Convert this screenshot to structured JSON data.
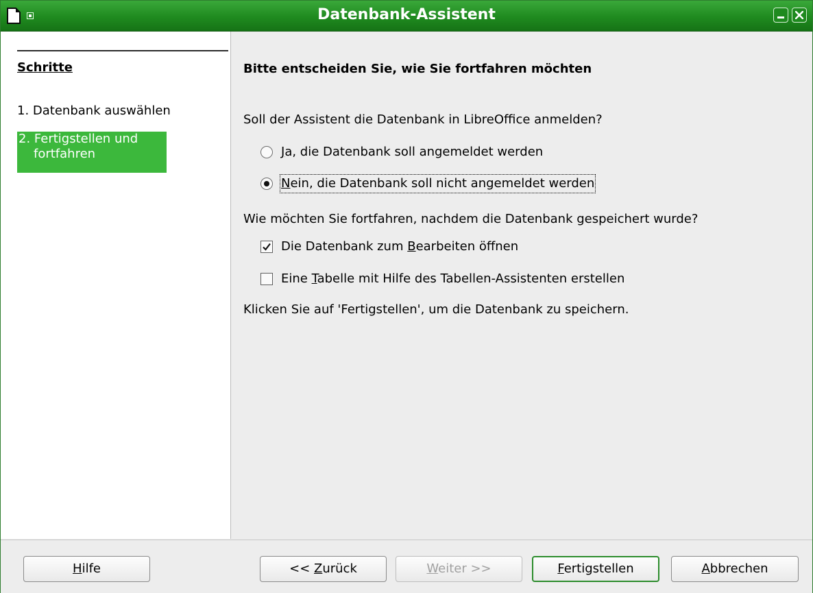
{
  "window": {
    "title": "Datenbank-Assistent",
    "icons": {
      "app": "document-icon",
      "menu": "window-menu-icon",
      "minimize": "minimize-icon",
      "close": "close-icon"
    }
  },
  "sidebar": {
    "heading": "Schritte",
    "steps": [
      {
        "label": "1. Datenbank auswählen",
        "active": false
      },
      {
        "label_line1": "2. Fertigstellen und",
        "label_line2": "fortfahren",
        "active": true
      }
    ]
  },
  "main": {
    "heading": "Bitte entscheiden Sie, wie Sie fortfahren möchten",
    "register_question": "Soll der Assistent die Datenbank in LibreOffice anmelden?",
    "register_options": [
      {
        "mnemonic": "J",
        "rest": "a, die Datenbank soll angemeldet werden",
        "selected": false
      },
      {
        "mnemonic": "N",
        "rest": "ein, die Datenbank soll nicht angemeldet werden",
        "selected": true
      }
    ],
    "continue_question": "Wie möchten Sie fortfahren, nachdem die Datenbank gespeichert wurde?",
    "continue_options": [
      {
        "before": "Die Datenbank zum ",
        "mnemonic": "B",
        "after": "earbeiten öffnen",
        "checked": true
      },
      {
        "before": "Eine ",
        "mnemonic": "T",
        "after": "abelle mit Hilfe des Tabellen-Assistenten erstellen",
        "checked": false
      }
    ],
    "note": "Klicken Sie auf 'Fertigstellen', um die Datenbank zu speichern."
  },
  "buttons": {
    "help": {
      "mnemonic": "H",
      "rest": "ilfe"
    },
    "back": {
      "before": "<< ",
      "mnemonic": "Z",
      "rest": "urück"
    },
    "next": {
      "mnemonic": "W",
      "rest": "eiter >>",
      "enabled": false
    },
    "finish": {
      "mnemonic": "F",
      "rest": "ertigstellen",
      "default": true
    },
    "cancel": {
      "mnemonic": "A",
      "rest": "bbrechen"
    }
  },
  "colors": {
    "accent": "#3cb83c",
    "titlebar": "#1f8a1f"
  }
}
